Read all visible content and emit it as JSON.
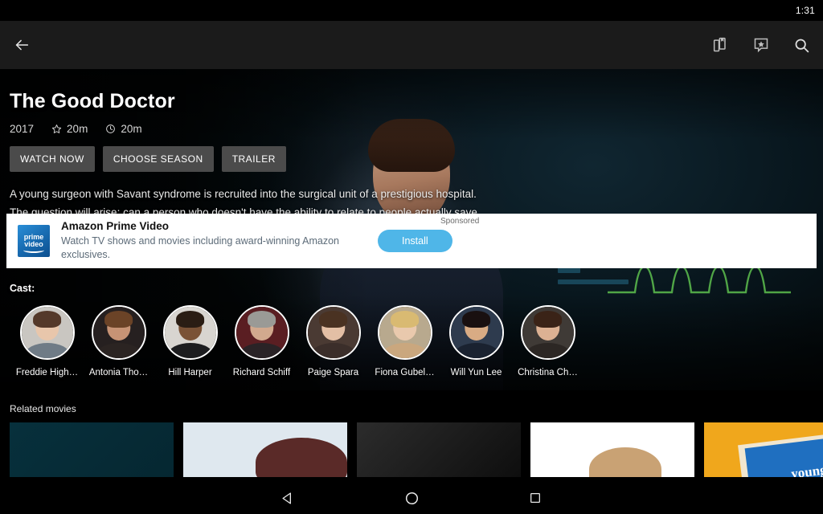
{
  "status_bar": {
    "time": "1:31"
  },
  "toolbar": {
    "back_label": "Back",
    "icons": [
      {
        "name": "library-icon",
        "label": "Library"
      },
      {
        "name": "chat-star-icon",
        "label": "Messages"
      },
      {
        "name": "search-icon",
        "label": "Search"
      }
    ]
  },
  "hero": {
    "title": "The Good Doctor",
    "meta": {
      "year": "2017",
      "rating_icon": "star-icon",
      "rating": "20m",
      "duration_icon": "clock-icon",
      "duration": "20m"
    },
    "buttons": [
      {
        "label": "WATCH NOW",
        "name": "watch-now-button"
      },
      {
        "label": "CHOOSE SEASON",
        "name": "choose-season-button"
      },
      {
        "label": "TRAILER",
        "name": "trailer-button"
      }
    ],
    "synopsis": "A young surgeon with Savant syndrome is recruited into the surgical unit of a prestigious hospital. The question will arise: can a person who doesn't have the ability to relate to people actually save their lives"
  },
  "ad": {
    "sponsored_label": "Sponsored",
    "icon_line1": "prime",
    "icon_line2": "video",
    "title": "Amazon Prime Video",
    "description": "Watch TV shows and movies including award-winning Amazon exclusives.",
    "cta_label": "Install",
    "cta_color": "#4fb6e8"
  },
  "cast": {
    "label": "Cast:",
    "members": [
      {
        "name": "Freddie High…",
        "skin": "#e8c6ab",
        "hair": "#54392a",
        "bg": "#c9c6c1",
        "body": "#6f7b86"
      },
      {
        "name": "Antonia Tho…",
        "skin": "#c79375",
        "hair": "#6b4327",
        "bg": "#262020",
        "body": "#2b2422"
      },
      {
        "name": "Hill Harper",
        "skin": "#7a5236",
        "hair": "#2a1d14",
        "bg": "#d8d5d0",
        "body": "#1d1d1f"
      },
      {
        "name": "Richard Schiff",
        "skin": "#d2a98e",
        "hair": "#9a9a96",
        "bg": "#5a1e22",
        "body": "#2a2326"
      },
      {
        "name": "Paige Spara",
        "skin": "#e3bfa5",
        "hair": "#4a3222",
        "bg": "#4a3a33",
        "body": "#3b2e2a"
      },
      {
        "name": "Fiona Gubel…",
        "skin": "#e9c9ad",
        "hair": "#d9ba72",
        "bg": "#b8a98e",
        "body": "#caa77e"
      },
      {
        "name": "Will Yun Lee",
        "skin": "#d8ab84",
        "hair": "#191010",
        "bg": "#2e3b4e",
        "body": "#1a2230"
      },
      {
        "name": "Christina Ch…",
        "skin": "#dcb193",
        "hair": "#3a2317",
        "bg": "#3f3a36",
        "body": "#2c2724"
      }
    ]
  },
  "related": {
    "label": "Related movies",
    "cards": [
      {
        "name": "related-card-1",
        "color_a": "#07303c",
        "color_b": "#052731"
      },
      {
        "name": "related-card-2",
        "color_a": "#dfe8ef",
        "color_b": "#5a2a28"
      },
      {
        "name": "related-card-3",
        "color_a": "#2c2c2c",
        "color_b": "#0e0e0e"
      },
      {
        "name": "related-card-4",
        "color_a": "#ffffff",
        "color_b": "#c9a274"
      },
      {
        "name": "related-card-5",
        "color_a": "#f0a71c",
        "color_b": "#1f6fc0",
        "caption": "young"
      }
    ]
  },
  "navbar": {
    "buttons": [
      {
        "name": "nav-back-button",
        "label": "Back"
      },
      {
        "name": "nav-home-button",
        "label": "Home"
      },
      {
        "name": "nav-recents-button",
        "label": "Recents"
      }
    ]
  }
}
